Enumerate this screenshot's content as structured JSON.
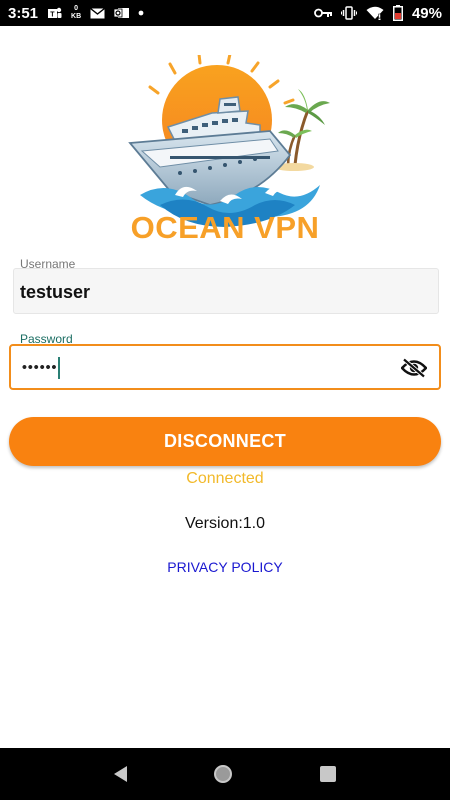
{
  "status_bar": {
    "time": "3:51",
    "data_speed_value": "0",
    "data_speed_unit": "KB",
    "battery": "49%"
  },
  "app": {
    "brand": "OCEAN VPN"
  },
  "form": {
    "username_label": "Username",
    "username_value": "testuser",
    "password_label": "Password",
    "password_value": "••••••"
  },
  "actions": {
    "disconnect_label": "DISCONNECT"
  },
  "connection": {
    "status": "Connected"
  },
  "footer": {
    "version": "Version:1.0",
    "privacy": "PRIVACY POLICY"
  },
  "colors": {
    "accent_orange": "#f98210",
    "status_yellow": "#f2b92a",
    "link_blue": "#1a18d0",
    "label_teal": "#1b6e63"
  },
  "icons": [
    "teams-icon",
    "kb-speed-icon",
    "mail-icon",
    "outlook-icon",
    "dot-icon",
    "vpn-key-icon",
    "vibrate-icon",
    "wifi-icon",
    "battery-icon",
    "visibility-off-icon",
    "back-icon",
    "home-icon",
    "recents-icon"
  ]
}
